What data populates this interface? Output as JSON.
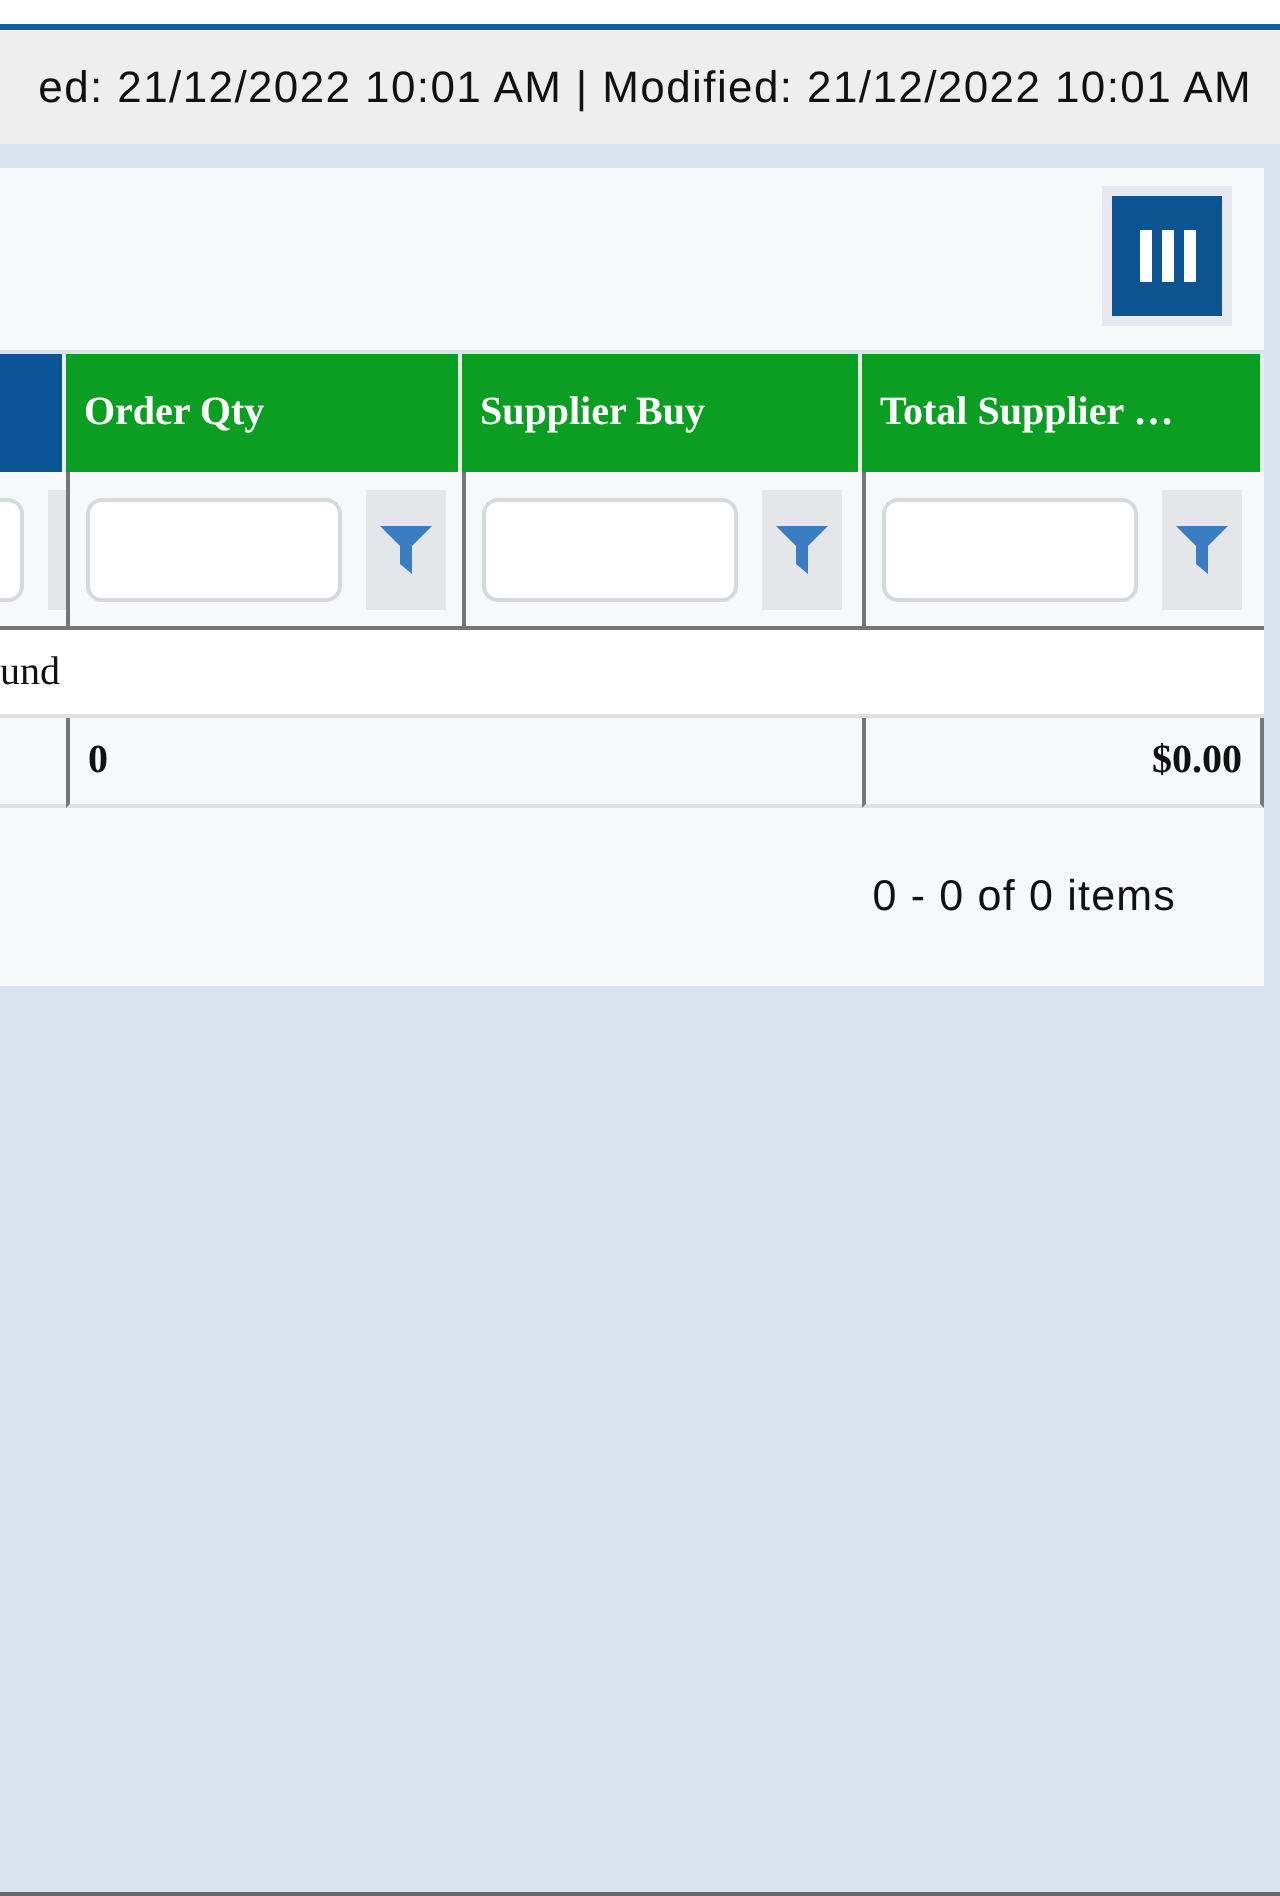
{
  "audit_bar": {
    "text": "ed: 21/12/2022 10:01 AM | Modified: 21/12/2022 10:01 AM"
  },
  "table": {
    "columns": [
      {
        "kind": "partial"
      },
      {
        "kind": "data",
        "label": "Order Qty"
      },
      {
        "kind": "data",
        "label": "Supplier Buy"
      },
      {
        "kind": "data",
        "label": "Total Supplier …"
      }
    ],
    "no_records": "und",
    "totals": [
      "0",
      "$0.00"
    ]
  },
  "pager": {
    "summary": "0 - 0 of 0 items"
  }
}
